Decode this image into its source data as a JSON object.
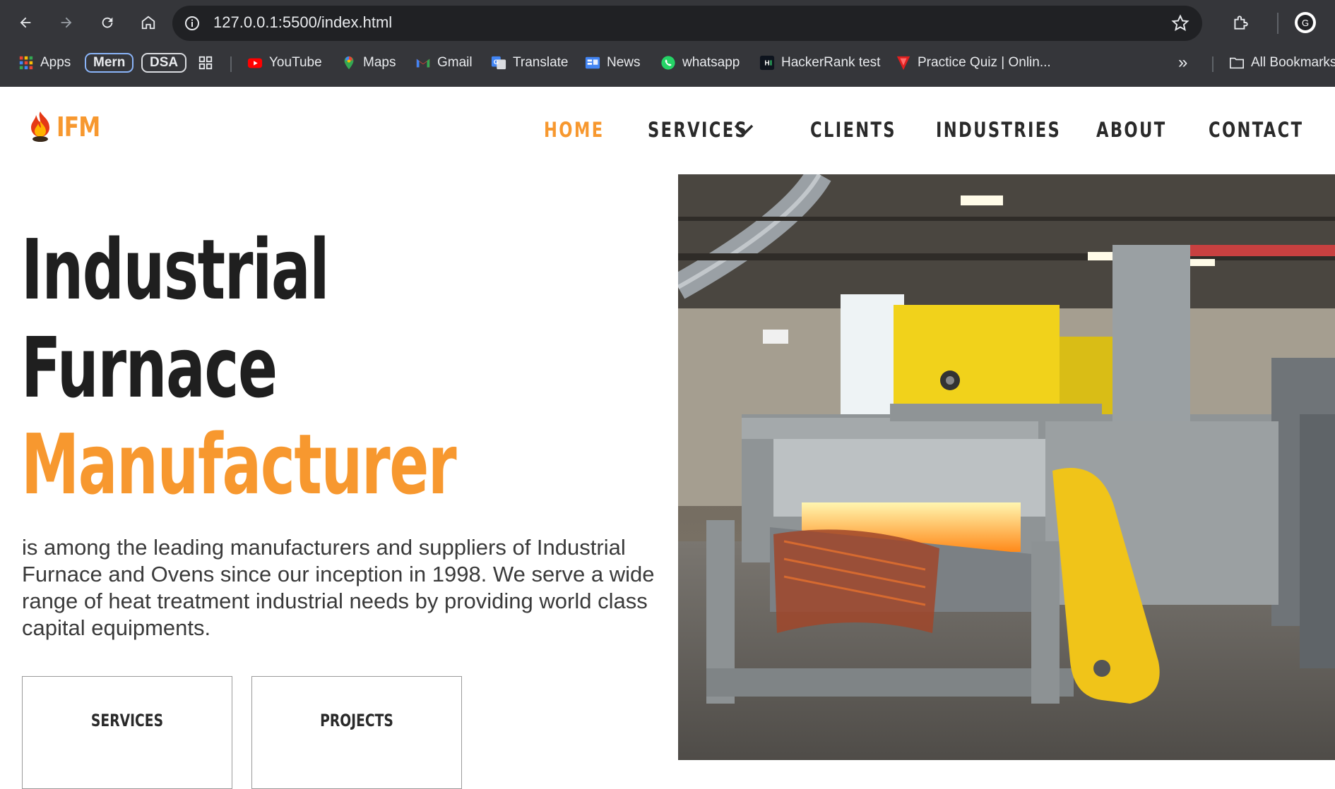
{
  "browser": {
    "url": "127.0.0.1:5500/index.html",
    "bookmarks": [
      {
        "label": "Apps",
        "icon": "apps-grid-icon"
      },
      {
        "label": "Mern",
        "icon": "pill"
      },
      {
        "label": "DSA",
        "icon": "pill"
      },
      {
        "label": "",
        "icon": "tab-groups-icon"
      },
      {
        "label": "YouTube",
        "icon": "youtube-icon"
      },
      {
        "label": "Maps",
        "icon": "maps-icon"
      },
      {
        "label": "Gmail",
        "icon": "gmail-icon"
      },
      {
        "label": "Translate",
        "icon": "translate-icon"
      },
      {
        "label": "News",
        "icon": "news-icon"
      },
      {
        "label": "whatsapp",
        "icon": "whatsapp-icon"
      },
      {
        "label": "HackerRank test",
        "icon": "hackerrank-icon"
      },
      {
        "label": "Practice Quiz | Onlin...",
        "icon": "quiz-icon"
      }
    ],
    "more_bookmarks": "»",
    "all_bookmarks": "All Bookmarks"
  },
  "site": {
    "logo": "IFM",
    "nav": [
      {
        "label": "HOME",
        "active": true
      },
      {
        "label": "SERVICES",
        "active": false
      },
      {
        "label": "CLIENTS",
        "active": false
      },
      {
        "label": "INDUSTRIES",
        "active": false
      },
      {
        "label": "ABOUT",
        "active": false
      },
      {
        "label": "CONTACT",
        "active": false
      }
    ],
    "hero": {
      "line1": "Industrial",
      "line2": "Furnace",
      "line3": "Manufacturer",
      "description": "is among the leading manufacturers and suppliers of Industrial Furnace and Ovens since our inception in 1998. We serve a wide range of heat treatment industrial needs by providing world class capital equipments.",
      "buttons": [
        "SERVICES",
        "PROJECTS"
      ]
    }
  },
  "colors": {
    "accent": "#f7982f",
    "chrome": "#35363a",
    "omnibox": "#202124"
  }
}
